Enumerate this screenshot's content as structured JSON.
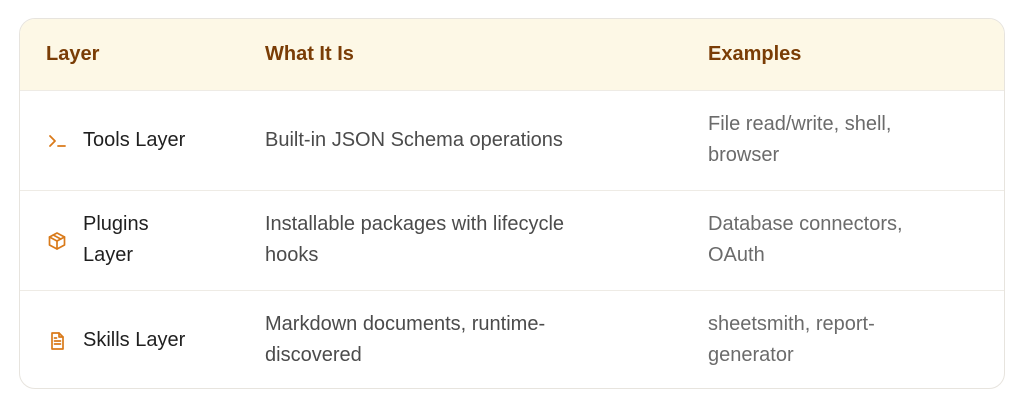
{
  "table": {
    "headers": {
      "layer": "Layer",
      "what": "What It Is",
      "examples": "Examples"
    },
    "rows": [
      {
        "icon": "terminal-prompt-icon",
        "name": "Tools Layer",
        "what": "Built-in JSON Schema operations",
        "examples_line1": "File read/write, shell,",
        "examples_line2": "browser"
      },
      {
        "icon": "package-box-icon",
        "name_line1": "Plugins",
        "name_line2": "Layer",
        "what_line1": "Installable packages with lifecycle",
        "what_line2": "hooks",
        "examples_line1": "Database connectors,",
        "examples_line2": "OAuth"
      },
      {
        "icon": "document-icon",
        "name": "Skills Layer",
        "what_line1": "Markdown documents, runtime-",
        "what_line2": "discovered",
        "examples_line1": "sheetsmith, report-",
        "examples_line2": "generator"
      }
    ]
  },
  "colors": {
    "header_bg": "#fdf8e6",
    "header_text": "#7a3d06",
    "icon": "#d97a1a",
    "border": "#e7e4de"
  }
}
